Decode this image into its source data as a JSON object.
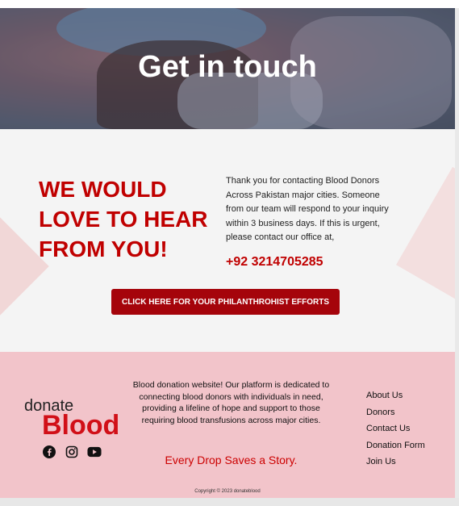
{
  "hero": {
    "title": "Get in touch"
  },
  "contact": {
    "heading": "WE WOULD LOVE TO HEAR FROM YOU!",
    "message": "Thank you for contacting Blood Donors Across Pakistan major cities. Someone from our team will respond to your inquiry within 3 business days. If this is urgent, please contact our office at,",
    "phone": "+92 3214705285",
    "cta_label": "CLICK HERE FOR YOUR PHILANTHROHIST EFFORTS"
  },
  "footer": {
    "logo_small": "donate",
    "logo_large": "Blood",
    "social_icons": [
      "facebook-icon",
      "instagram-icon",
      "youtube-icon"
    ],
    "mission": "Blood donation website! Our platform is dedicated to connecting blood donors with individuals in need, providing a lifeline of hope and support to those requiring blood transfusions across major cities.",
    "tagline": "Every Drop Saves a Story.",
    "links": [
      "About Us",
      "Donors",
      "Contact Us",
      "Donation Form",
      "Join Us"
    ],
    "copyright": "Copyright © 2023 donateblood"
  },
  "colors": {
    "brand_red": "#c00000",
    "button_red": "#a5040b",
    "footer_pink": "#f2c4ca"
  }
}
